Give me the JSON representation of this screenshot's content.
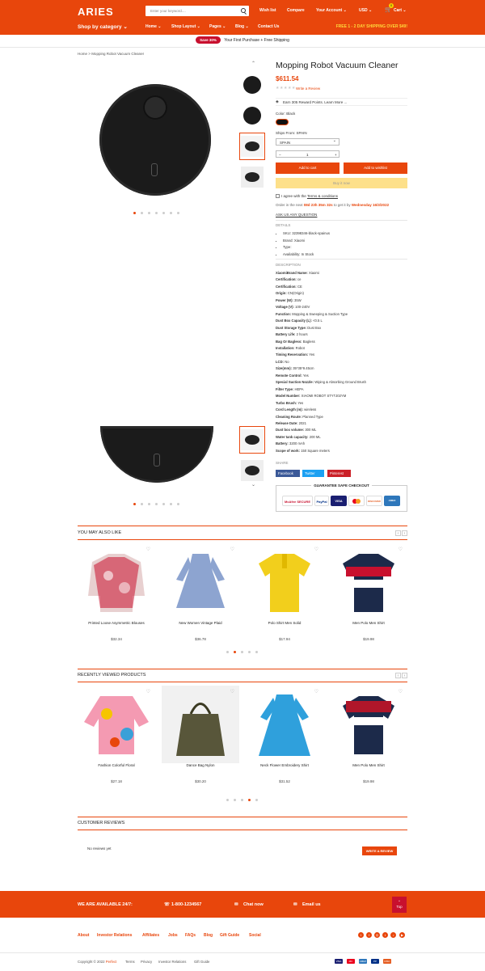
{
  "header": {
    "logo": "ARIES",
    "search_placeholder": "Enter your keyword....",
    "wishlist": "Wish list",
    "compare": "Compare",
    "account": "Your Account ⌄",
    "currency": "USD ⌄",
    "cart": "Cart ⌄",
    "cart_count": "0"
  },
  "nav": {
    "category": "Shop by category",
    "items": [
      "Home ⌄",
      "Shop Layout ⌄",
      "Pages ⌄",
      "Blog ⌄",
      "Contact Us"
    ],
    "shipping": "FREE 1 - 2 DAY SHIPPING OVER $49!"
  },
  "promo": {
    "badge": "Save 30%",
    "text": "Your First Purchase + Free Shipping"
  },
  "breadcrumb": {
    "home": "Home",
    "sep": ">",
    "current": "Mopping Robot Vacuum Cleaner"
  },
  "product": {
    "title": "Mopping Robot Vacuum Cleaner",
    "price": "$611.54",
    "write_review": "Write a Review",
    "reward": "Earn 305 Reward Points.",
    "learn_more": "Learn More ...",
    "color_label": "Color: Black",
    "ships_label": "Ships From: SPAIN",
    "ships_value": "SPAIN",
    "qty_minus": "−",
    "qty_value": "1",
    "qty_plus": "+",
    "add_to_cart": "Add to cart",
    "add_to_wishlist": "Add to wishlist",
    "buy_now": "Buy it now",
    "agree_prefix": "I agree with the",
    "agree_link": "Terms & conditions",
    "order_prefix": "Order in the next",
    "order_time": "08d 23h 35m 32s",
    "order_mid": "to get it by",
    "order_date": "Wednesday 16/3/2022",
    "ask": "ASK US ANY QUESTION",
    "details_label": "DETAILS",
    "details": [
      "SKU: 32398346-black-spainus",
      "Brand: Xiaomi",
      "Type:",
      "Availability: In Stock"
    ],
    "description_label": "DESCRIPTION",
    "specs": [
      [
        "XiaomiBrand Name:",
        "Xiaomi"
      ],
      [
        "Certification:",
        "ce"
      ],
      [
        "Certification:",
        "CE"
      ],
      [
        "Origin:",
        "CN(Origin)"
      ],
      [
        "Power (W):",
        "35W"
      ],
      [
        "Voltage (V):",
        "100-240V"
      ],
      [
        "Function:",
        "Mopping & Sweeping & Suction Type"
      ],
      [
        "Dust Box Capacity (L):",
        "<0.5 L"
      ],
      [
        "Dust Storage Type:",
        "Dust Box"
      ],
      [
        "Battery Life:",
        "2 hours"
      ],
      [
        "Bag Or Bagless:",
        "Bagless"
      ],
      [
        "Installation:",
        "Robot"
      ],
      [
        "Timing Reservation:",
        "Yes"
      ],
      [
        "LCD:",
        "No"
      ],
      [
        "Size(mm):",
        "35*35*9.45cm"
      ],
      [
        "Remote Control:",
        "Yes"
      ],
      [
        "Special Suction Nozzle:",
        "Wiping & Absorbing Ground Brush"
      ],
      [
        "Filter Type:",
        "HEPA"
      ],
      [
        "Model Number:",
        "XIAOMI ROBOT STYTJ02YM"
      ],
      [
        "Turbo Brush:",
        "Yes"
      ],
      [
        "Cord Length (m):",
        "wireless"
      ],
      [
        "Cleaning Route:",
        "Planned Type"
      ],
      [
        "Release Date:",
        "2021"
      ],
      [
        "Dust box volume:",
        "300 ML"
      ],
      [
        "Water tank capacity:",
        "200 ML"
      ],
      [
        "Battery:",
        "3200 mAh"
      ],
      [
        "Scope of work:",
        "150 Square meters"
      ]
    ],
    "share_label": "SHARE",
    "share": [
      "Facebook",
      "Twitter",
      "Pinterest"
    ],
    "guarantee": "GUARANTEE SAFE CHECKOUT",
    "pay_badges": [
      "McAfee SECURE",
      "PayPal",
      "VISA",
      "",
      "DISCOVER",
      "AMEX"
    ]
  },
  "also_like": {
    "title": "YOU MAY ALSO LIKE",
    "products": [
      {
        "name": "Printed Loose Asymmetric Blouses",
        "price": "$32.34"
      },
      {
        "name": "New Women Vintage Plaid",
        "price": "$36.78"
      },
      {
        "name": "Polo Shirt Men Solid",
        "price": "$17.94"
      },
      {
        "name": "Men Polo Men Shirt",
        "price": "$19.98"
      }
    ]
  },
  "recent": {
    "title": "RECENTLY VIEWED PRODUCTS",
    "products": [
      {
        "name": "Fashion Colorful Floral",
        "price": "$27.18"
      },
      {
        "name": "Dance Bag Nylon",
        "price": "$30.20"
      },
      {
        "name": "Neck Flower Embroidery Shirt",
        "price": "$31.52"
      },
      {
        "name": "Men Polo Men Shirt",
        "price": "$19.98"
      }
    ]
  },
  "reviews": {
    "title": "CUSTOMER REVIEWS",
    "empty": "No reviews yet",
    "write": "WRITE A REVIEW"
  },
  "footer": {
    "available": "WE ARE AVAILABLE 24/7:",
    "phone": "1-800-1234567",
    "chat": "Chat now",
    "email": "Email us",
    "top": "Top",
    "links": [
      "About",
      "Investor Relations",
      "Affiliates",
      "Jobs",
      "FAQs",
      "Blog",
      "Gift Guide",
      "Social"
    ],
    "copy_prefix": "Copyright © 2022",
    "copy_brand": "Perfect",
    "bottom_links": [
      "Terms",
      "Privacy",
      "Investor Relations",
      "Gift Guide"
    ],
    "payments": [
      "VISA",
      "MC",
      "AMEX",
      "PP",
      "DISC"
    ]
  },
  "colors": {
    "accent": "#e8460c",
    "yellow": "#ffd83a"
  }
}
